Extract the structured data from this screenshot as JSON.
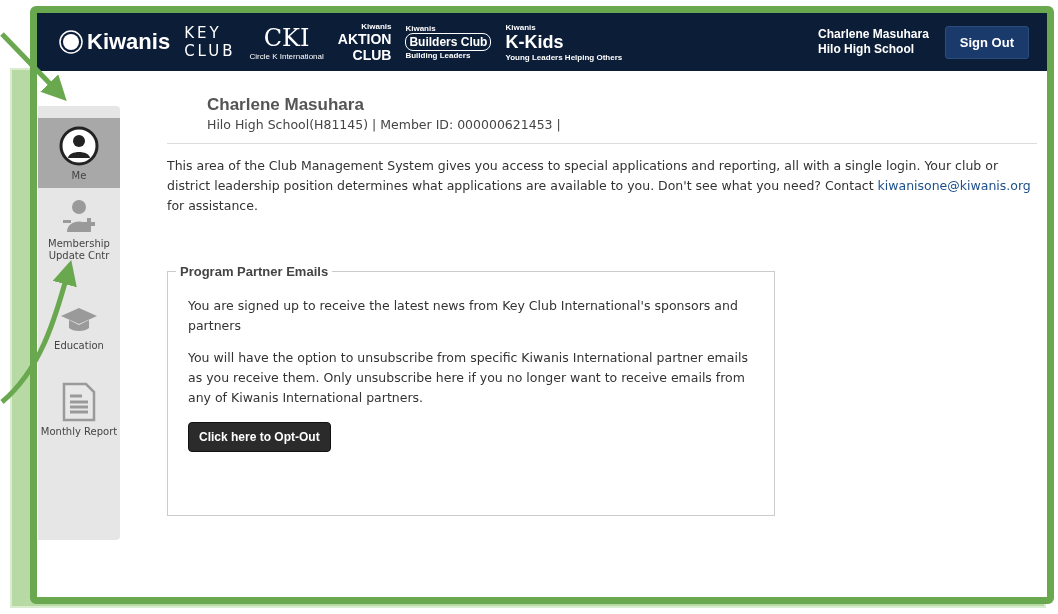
{
  "header": {
    "logos": [
      {
        "kind": "kiwanis",
        "lines": [
          "Kiwanis"
        ]
      },
      {
        "kind": "keyclub",
        "lines": [
          "KEY",
          "CLUB"
        ]
      },
      {
        "kind": "cki",
        "lines": [
          "CKI",
          "Circle K International"
        ]
      },
      {
        "kind": "aktion",
        "lines": [
          "Kiwanis",
          "AKTION",
          "CLUB"
        ]
      },
      {
        "kind": "builders",
        "lines": [
          "Kiwanis",
          "Builders Club",
          "Building Leaders"
        ]
      },
      {
        "kind": "kkids",
        "lines": [
          "Kiwanis",
          "K-Kids",
          "Young Leaders Helping Others"
        ]
      }
    ],
    "user_name": "Charlene Masuhara",
    "user_school": "Hilo High School",
    "sign_out": "Sign Out"
  },
  "sidebar": {
    "items": [
      {
        "kind": "person",
        "label": "Me",
        "selected": true
      },
      {
        "kind": "person-add",
        "label": "Membership Update Cntr",
        "selected": false
      },
      {
        "kind": "cap",
        "label": "Education",
        "selected": false
      },
      {
        "kind": "document",
        "label": "Monthly Report",
        "selected": false
      }
    ]
  },
  "profile": {
    "name": "Charlene Masuhara",
    "details": "Hilo High School(H81145) | Member ID: 000000621453 |"
  },
  "intro": {
    "text_before": "This area of the Club Management System gives you access to special applications and reporting, all with a single login. Your club or district leadership position determines what applications are available to you. Don't see what you need? Contact ",
    "link": "kiwanisone@kiwanis.org",
    "text_after": " for assistance."
  },
  "panel": {
    "title": "Program Partner Emails",
    "paragraphs": [
      "You are signed up to receive the latest news from Key Club International's sponsors and partners",
      "You will have the option to unsubscribe from specific Kiwanis International partner emails as you receive them. Only unsubscribe here if you no longer want to receive emails from any of Kiwanis International partners."
    ],
    "button": "Click here to Opt-Out"
  }
}
